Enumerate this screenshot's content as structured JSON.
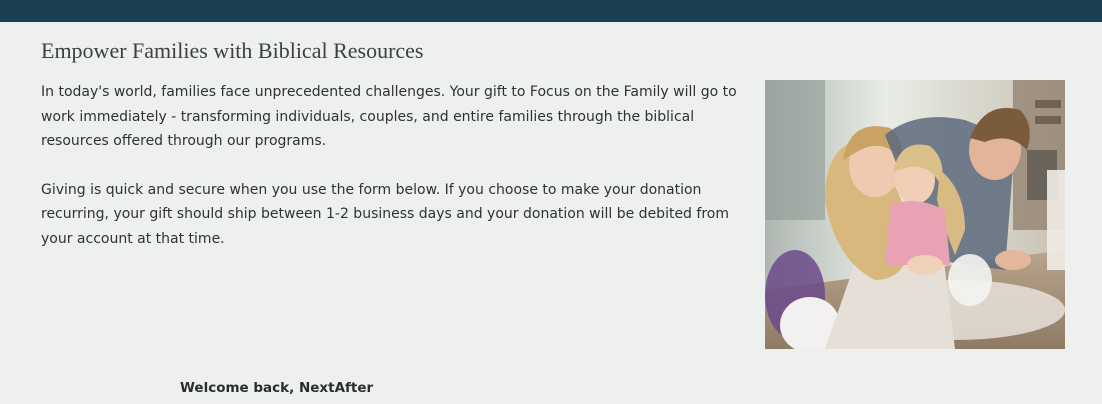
{
  "header_bar": {
    "color": "#1b4051"
  },
  "content": {
    "heading": "Empower Families with Biblical Resources",
    "paragraph_1": "In today's world, families face unprecedented challenges. Your gift to Focus on the Family will go to work immediately - transforming individuals, couples, and entire families through the biblical resources offered through our programs.",
    "paragraph_2": "Giving is quick and secure when you use the form below. If you choose to make your donation recurring, your gift should ship between 1-2 business days and your donation will be debited from your account at that time."
  },
  "image": {
    "subject": "family-baking-photo"
  },
  "account": {
    "welcome_text": "Welcome back, NextAfter"
  }
}
